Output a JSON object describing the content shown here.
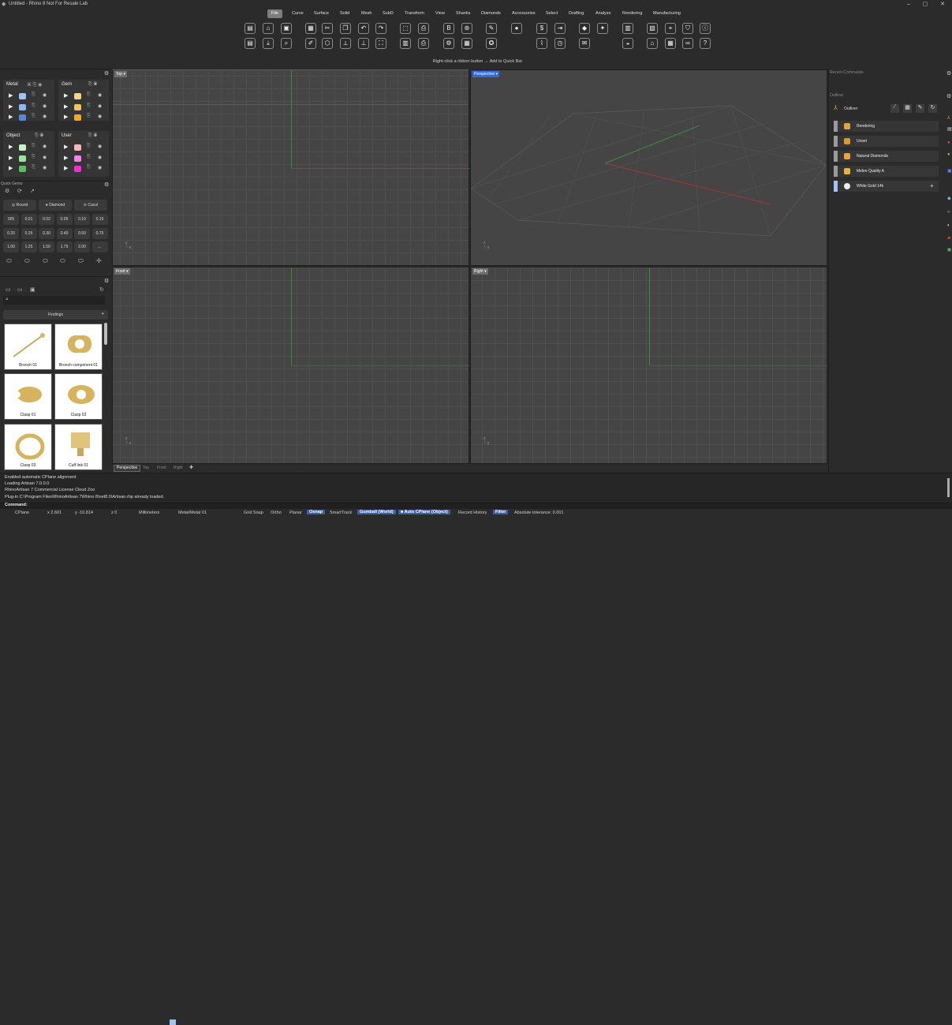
{
  "window": {
    "title": "Untitled - Rhino 8 Not For Resale Lab",
    "min": "–",
    "max": "▢",
    "close": "✕"
  },
  "menu_tabs": [
    "File",
    "Curve",
    "Surface",
    "Solid",
    "Mesh",
    "SubD",
    "Transform",
    "View",
    "Shanks",
    "Diamonds",
    "Accessories",
    "Select",
    "Drafting",
    "Analyze",
    "Rendering",
    "Manufacturing"
  ],
  "ribbon_hint": "Right-click a ribbon button → Add to Quick Bar",
  "materials": {
    "metal": "Metal",
    "gem": "Gem",
    "object": "Object",
    "user": "User",
    "metal_colors": [
      "#9fc3f2",
      "#8fb6ee",
      "#5a86d8"
    ],
    "gem_colors": [
      "#f6d38a",
      "#f3c15d",
      "#f0a82a"
    ],
    "object_colors": [
      "#c7f2c5",
      "#9be59a",
      "#5bbf62"
    ],
    "user_colors": [
      "#f4b8b8",
      "#f184e6",
      "#f22bdc"
    ]
  },
  "quick_gems": {
    "title": "Quick Gems",
    "cut_round": "Round",
    "cut_diamond": "Diamond",
    "cut_cacul": "Cacul",
    "sizes": [
      "005",
      "0.01",
      "0.02",
      "0.05",
      "0.10",
      "0.15",
      "0.20",
      "0.25",
      "0.30",
      "0.40",
      "0.50",
      "0.75",
      "1.00",
      "1.25",
      "1.50",
      "1.75",
      "2.00",
      "..."
    ]
  },
  "library": {
    "section": "Findings",
    "items": [
      "Brooch 01",
      "Brooch component 01",
      "Clasp 01",
      "Clasp 02",
      "Clasp 03",
      "Cuff link 01"
    ]
  },
  "viewports": {
    "top": "Top",
    "perspective": "Perspective",
    "front": "Front",
    "right": "Right",
    "tabs": [
      "Perspective",
      "Top",
      "Front",
      "Right",
      "✚"
    ]
  },
  "right_panel": {
    "recent": "Recent Commands",
    "outliner_section": "Outliner",
    "outliner_title": "Outliner",
    "rows": [
      "Rendering",
      "Unset",
      "Natural Diamonds",
      "Melee Quality A",
      "White Gold 14k"
    ]
  },
  "command_history": [
    "Enabled automatic CPlane alignment",
    "Loading Artisan 7.0.0.0",
    "RhinoArtisan 7 Commercial License Cloud Zoo",
    "Plug-in C:\\Program Files\\RhinoArtisan 7\\Rhino 8\\net8.0\\Artisan.rhp already loaded."
  ],
  "command_prompt": "Command:",
  "status": {
    "cplane": "CPlane",
    "x": "x 2.601",
    "y": "y -10.814",
    "z": "z 0",
    "units": "Millimeters",
    "layer": "Metal/Metal 01",
    "grid_snap": "Grid Snap",
    "ortho": "Ortho",
    "planar": "Planar",
    "osnap": "Osnap",
    "smarttrack": "SmartTrack",
    "gumball": "Gumball (World)",
    "auto_cplane": "Auto CPlane (Object)",
    "record_history": "Record History",
    "filter": "Filter",
    "tolerance": "Absolute tolerance: 0.001"
  }
}
